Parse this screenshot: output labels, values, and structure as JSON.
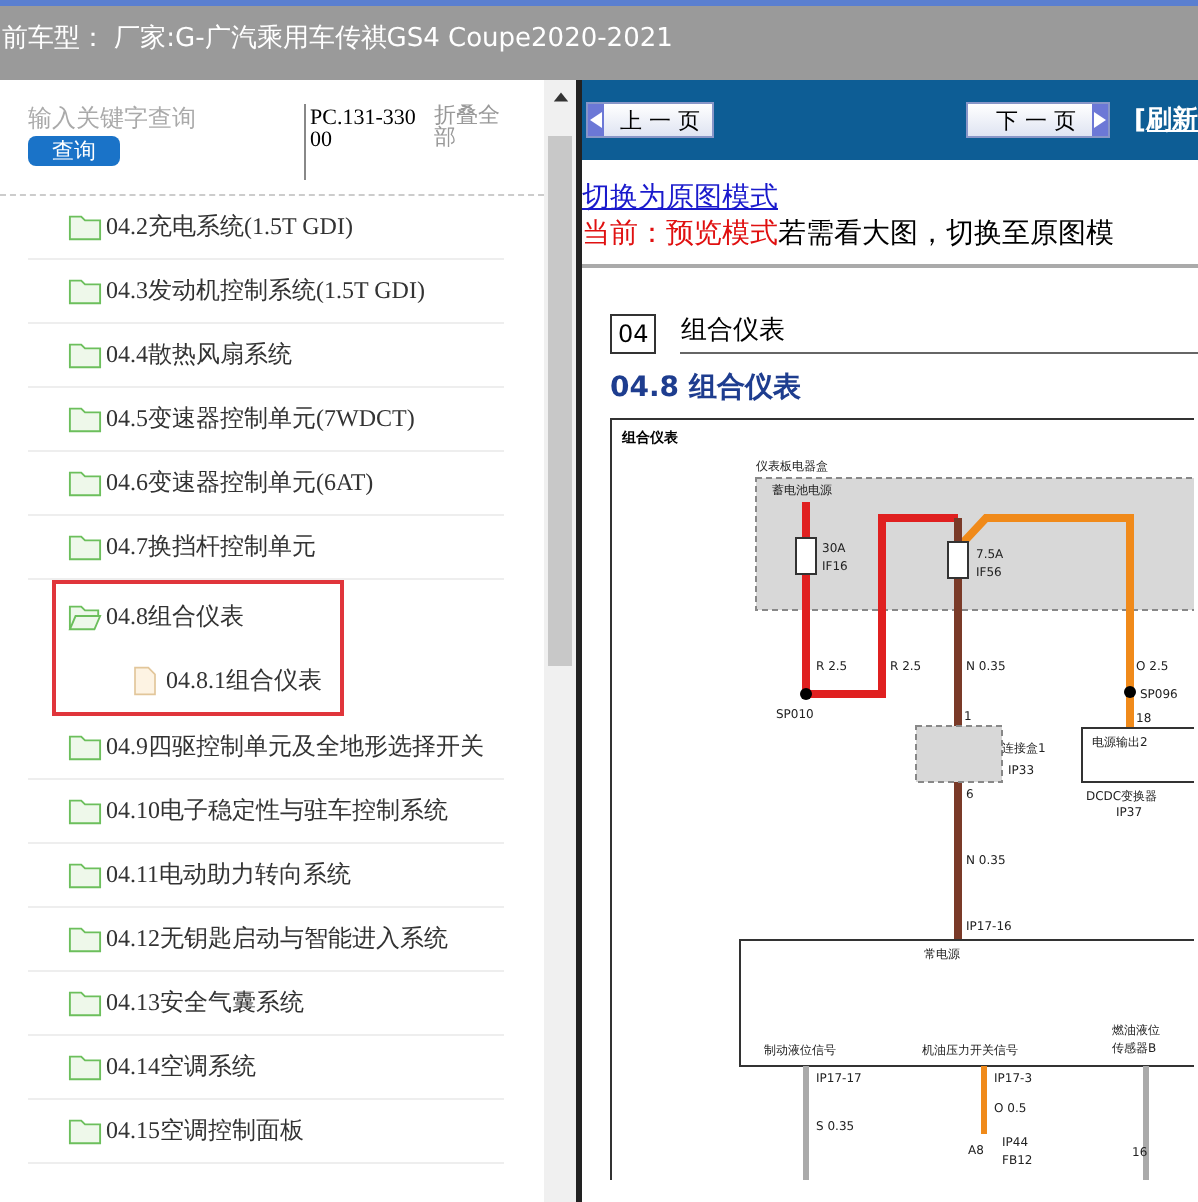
{
  "top_bar": {
    "title": "前车型： 厂家:G-广汽乘用车传祺GS4 Coupe2020-2021"
  },
  "sidebar": {
    "search": {
      "placeholder": "输入关键字查询"
    },
    "search_button": "查询",
    "code": "PC.131-33000",
    "collapse_all": "折叠全部"
  },
  "tree": {
    "items": [
      {
        "label": "04.2充电系统(1.5T GDI)",
        "kind": "folder",
        "expanded": false,
        "highlighted": false
      },
      {
        "label": "04.3发动机控制系统(1.5T GDI)",
        "kind": "folder",
        "expanded": false,
        "highlighted": false
      },
      {
        "label": "04.4散热风扇系统",
        "kind": "folder",
        "expanded": false,
        "highlighted": false
      },
      {
        "label": "04.5变速器控制单元(7WDCT)",
        "kind": "folder",
        "expanded": false,
        "highlighted": false
      },
      {
        "label": "04.6变速器控制单元(6AT)",
        "kind": "folder",
        "expanded": false,
        "highlighted": false
      },
      {
        "label": "04.7换挡杆控制单元",
        "kind": "folder",
        "expanded": false,
        "highlighted": false
      },
      {
        "label": "04.8组合仪表",
        "kind": "folder",
        "expanded": true,
        "highlighted": true,
        "children": [
          {
            "label": "04.8.1组合仪表",
            "kind": "file"
          }
        ]
      },
      {
        "label": "04.9四驱控制单元及全地形选择开关",
        "kind": "folder",
        "expanded": false,
        "highlighted": false
      },
      {
        "label": "04.10电子稳定性与驻车控制系统",
        "kind": "folder",
        "expanded": false,
        "highlighted": false
      },
      {
        "label": "04.11电动助力转向系统",
        "kind": "folder",
        "expanded": false,
        "highlighted": false
      },
      {
        "label": "04.12无钥匙启动与智能进入系统",
        "kind": "folder",
        "expanded": false,
        "highlighted": false
      },
      {
        "label": "04.13安全气囊系统",
        "kind": "folder",
        "expanded": false,
        "highlighted": false
      },
      {
        "label": "04.14空调系统",
        "kind": "folder",
        "expanded": false,
        "highlighted": false
      },
      {
        "label": "04.15空调控制面板",
        "kind": "folder",
        "expanded": false,
        "highlighted": false
      }
    ]
  },
  "toolbar": {
    "prev_button": "上 一 页",
    "next_button": "下 一 页",
    "refresh_link": "[刷新"
  },
  "content": {
    "mode_link": "切换为原图模式",
    "mode_status": "当前：预览模式",
    "mode_hint": "若需看大图，切换至原图模",
    "chapter_number": "04",
    "chapter_title": "组合仪表",
    "section_title": "04.8 组合仪表",
    "diagram": {
      "title": "组合仪表",
      "labels": [
        "仪表板电器盒",
        "蓄电池电源",
        "30A",
        "IF16",
        "7.5A",
        "IF56",
        "R 2.5",
        "R 2.5",
        "N 0.35",
        "O 2.5",
        "SP010",
        "SP096",
        "1",
        "18",
        "连接盒1",
        "IP33",
        "6",
        "电源输出2",
        "DCDC变换器",
        "IP37",
        "N 0.35",
        "IP17-16",
        "常电源",
        "制动液位信号",
        "机油压力开关信号",
        "燃油液位",
        "传感器B",
        "IP17-17",
        "IP17-3",
        "S 0.35",
        "O 0.5",
        "A8",
        "IP44",
        "FB12",
        "16"
      ]
    }
  }
}
